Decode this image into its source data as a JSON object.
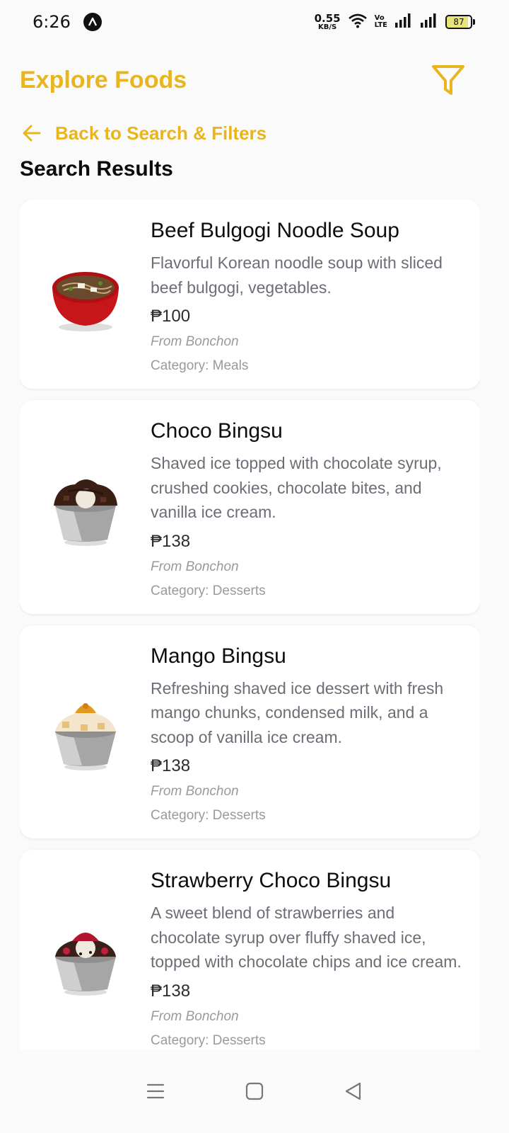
{
  "status_bar": {
    "time": "6:26",
    "net_speed_value": "0.55",
    "net_speed_unit": "KB/S",
    "volte_top": "Vo",
    "volte_bottom": "LTE",
    "battery_level": "87",
    "battery_fraction": 0.87
  },
  "header": {
    "title": "Explore Foods",
    "filter_icon": "filter-icon"
  },
  "back_link": {
    "icon": "arrow-left-icon",
    "label": "Back to Search & Filters"
  },
  "section_title": "Search Results",
  "results": [
    {
      "name": "Beef Bulgogi Noodle Soup",
      "description": "Flavorful Korean noodle soup with sliced beef bulgogi, vegetables.",
      "price": "₱100",
      "source": "From Bonchon",
      "category": "Category: Meals"
    },
    {
      "name": "Choco Bingsu",
      "description": "Shaved ice topped with chocolate syrup, crushed cookies, chocolate bites, and vanilla ice cream.",
      "price": "₱138",
      "source": "From Bonchon",
      "category": "Category: Desserts"
    },
    {
      "name": "Mango Bingsu",
      "description": "Refreshing shaved ice dessert with fresh mango chunks, condensed milk, and a scoop of vanilla ice cream.",
      "price": "₱138",
      "source": "From Bonchon",
      "category": "Category: Desserts"
    },
    {
      "name": "Strawberry Choco Bingsu",
      "description": "A sweet blend of strawberries and chocolate syrup over fluffy shaved ice, topped with chocolate chips and ice cream.",
      "price": "₱138",
      "source": "From Bonchon",
      "category": "Category: Desserts"
    }
  ],
  "nav_bar": {
    "menu_icon": "menu-icon",
    "home_icon": "home-square-icon",
    "back_icon": "back-triangle-icon"
  },
  "colors": {
    "accent": "#e9b51f",
    "text_primary": "#0d0d0d",
    "text_secondary": "#6b6e76",
    "text_muted": "#9a9a9a",
    "card_bg": "#ffffff",
    "page_bg": "#fafafa"
  }
}
